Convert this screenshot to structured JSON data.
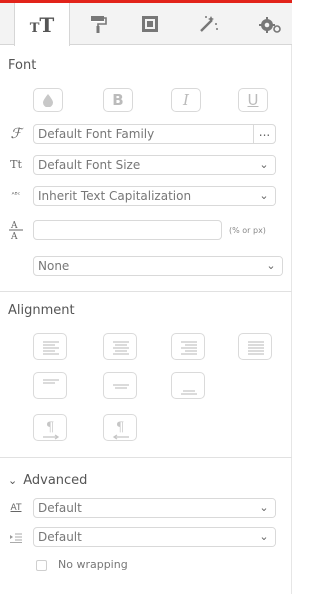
{
  "tabs": [
    {
      "name": "typography",
      "icon": "typography-icon",
      "active": true
    },
    {
      "name": "paint-roller",
      "icon": "paint-roller-icon",
      "active": false
    },
    {
      "name": "box-model",
      "icon": "box-model-icon",
      "active": false
    },
    {
      "name": "effects",
      "icon": "magic-wand-icon",
      "active": false
    },
    {
      "name": "settings",
      "icon": "gears-icon",
      "active": false
    }
  ],
  "font": {
    "title": "Font",
    "style_buttons": [
      {
        "name": "color",
        "icon": "drop-icon"
      },
      {
        "name": "bold",
        "label": "B"
      },
      {
        "name": "italic",
        "label": "I"
      },
      {
        "name": "underline",
        "label": "U"
      }
    ],
    "family_value": "Default Font Family",
    "family_button": "...",
    "size_value": "Default Font Size",
    "capitalization_value": "Inherit Text Capitalization",
    "line_height_value": "",
    "line_height_unit": "(% or px)",
    "extra_select_value": "None"
  },
  "alignment": {
    "title": "Alignment"
  },
  "advanced": {
    "title": "Advanced",
    "letter_spacing_value": "Default",
    "text_indent_value": "Default",
    "wrapping_label": "No wrapping",
    "wrapping_checked": false
  },
  "colors": {
    "accent": "#e2231a",
    "border": "#d9d9d9",
    "text": "#555555"
  }
}
